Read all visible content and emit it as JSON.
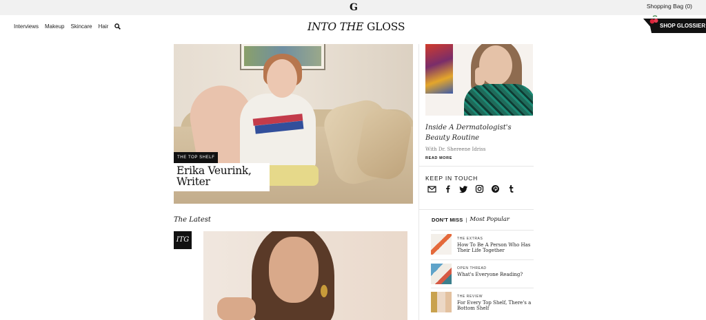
{
  "topbar": {
    "logo_glyph": "G",
    "shopping_bag": "Shopping Bag (0)"
  },
  "nav": {
    "items": [
      "Interviews",
      "Makeup",
      "Skincare",
      "Hair"
    ]
  },
  "site_logo": {
    "part1": "INTO THE",
    "part2": "GLOSS"
  },
  "shop_button": "SHOP GLOSSIER",
  "hero": {
    "tag": "THE TOP SHELF",
    "title": "Erika Veurink, Writer"
  },
  "sidebar_story": {
    "title": "Inside A Dermatologist's Beauty Routine",
    "byline": "With Dr. Shereene Idriss",
    "read_more": "READ MORE"
  },
  "keep_in_touch": {
    "label": "KEEP IN TOUCH",
    "icons": [
      "email-icon",
      "facebook-icon",
      "twitter-icon",
      "instagram-icon",
      "pinterest-icon",
      "tumblr-icon"
    ]
  },
  "dont_miss": {
    "label": "DON'T MISS",
    "separator": "|",
    "popular": "Most Popular",
    "items": [
      {
        "kicker": "THE EXTRAS",
        "title": "How To Be A Person Who Has Their Life Together"
      },
      {
        "kicker": "OPEN THREAD",
        "title": "What's Everyone Reading?"
      },
      {
        "kicker": "THE REVIEW",
        "title": "For Every Top Shelf, There's a Bottom Shelf"
      }
    ]
  },
  "latest": {
    "heading": "The Latest",
    "badge": "ITG"
  },
  "colors": {
    "accent_black": "#111111",
    "topbar_bg": "#f1f1f1",
    "divider": "#e6e6e6"
  }
}
